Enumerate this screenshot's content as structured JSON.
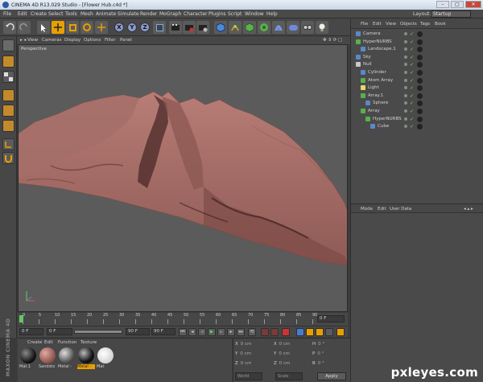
{
  "window": {
    "title": "CINEMA 4D R13.029 Studio - [Flower Hub.c4d *]",
    "min": "–",
    "max": "□",
    "close": "✕"
  },
  "menubar": [
    "File",
    "Edit",
    "Create",
    "Select",
    "Tools",
    "Mesh",
    "Animate",
    "Simulate",
    "Render",
    "MoGraph",
    "Character",
    "Plugins",
    "Script",
    "Window",
    "Help"
  ],
  "layout": {
    "label": "Layout:",
    "value": "Startup"
  },
  "toolbar": {
    "axes": [
      "X",
      "Y",
      "Z"
    ]
  },
  "viewport": {
    "menu": [
      "View",
      "Cameras",
      "Display",
      "Options",
      "Filter",
      "Panel"
    ],
    "label": "Perspective"
  },
  "timeline": {
    "ticks": [
      "0",
      "5",
      "10",
      "15",
      "20",
      "25",
      "30",
      "35",
      "40",
      "45",
      "50",
      "55",
      "60",
      "65",
      "70",
      "75",
      "80",
      "85",
      "90"
    ],
    "current_frame": "0 F"
  },
  "transport": {
    "start": "0 F",
    "preview_start": "0 F",
    "preview_end": "90 F",
    "end": "90 F"
  },
  "materials": {
    "menu": [
      "Create",
      "Edit",
      "Function",
      "Texture"
    ],
    "items": [
      {
        "label": "Mat.1",
        "color": "#1a1a1a"
      },
      {
        "label": "Sandsto",
        "color": "#b36f6a"
      },
      {
        "label": "Metal -",
        "color": "#6b6b6b"
      },
      {
        "label": "Metal -",
        "color": "#2b2b2b",
        "selected": true
      },
      {
        "label": "Mat",
        "color": "#f2f2f2"
      }
    ],
    "brand": "MAXON CINEMA 4D"
  },
  "coordinates": {
    "rows": [
      [
        {
          "axis": "X",
          "val": "0 cm"
        },
        {
          "axis": "X",
          "val": "0 cm"
        },
        {
          "axis": "H",
          "val": "0 °"
        }
      ],
      [
        {
          "axis": "Y",
          "val": "0 cm"
        },
        {
          "axis": "Y",
          "val": "0 cm"
        },
        {
          "axis": "P",
          "val": "0 °"
        }
      ],
      [
        {
          "axis": "Z",
          "val": "0 cm"
        },
        {
          "axis": "Z",
          "val": "0 cm"
        },
        {
          "axis": "B",
          "val": "0 °"
        }
      ]
    ],
    "mode1": "World",
    "mode2": "Scale",
    "apply": "Apply"
  },
  "objects": {
    "menu": [
      "File",
      "Edit",
      "View",
      "Objects",
      "Tags",
      "Book"
    ],
    "rows": [
      {
        "name": "Camera",
        "indent": 0,
        "icon": "#5a88c8"
      },
      {
        "name": "HyperNURBS",
        "indent": 0,
        "icon": "#5ab04a"
      },
      {
        "name": "Landscape.1",
        "indent": 1,
        "icon": "#5a88c8"
      },
      {
        "name": "Sky",
        "indent": 0,
        "icon": "#5a88c8"
      },
      {
        "name": "Null",
        "indent": 0,
        "icon": "#c8c8c8"
      },
      {
        "name": "Cylinder",
        "indent": 1,
        "icon": "#5a88c8"
      },
      {
        "name": "Atom Array",
        "indent": 1,
        "icon": "#5ab04a"
      },
      {
        "name": "Light",
        "indent": 1,
        "icon": "#e8d86a"
      },
      {
        "name": "Array.1",
        "indent": 1,
        "icon": "#5ab04a"
      },
      {
        "name": "Sphere",
        "indent": 2,
        "icon": "#5a88c8"
      },
      {
        "name": "Array",
        "indent": 1,
        "icon": "#5ab04a"
      },
      {
        "name": "HyperNURBS",
        "indent": 2,
        "icon": "#5ab04a"
      },
      {
        "name": "Cube",
        "indent": 3,
        "icon": "#5a88c8"
      }
    ]
  },
  "attributes": {
    "menu": [
      "Mode",
      "Edit",
      "User Data"
    ]
  },
  "watermark": "pxleyes.com"
}
